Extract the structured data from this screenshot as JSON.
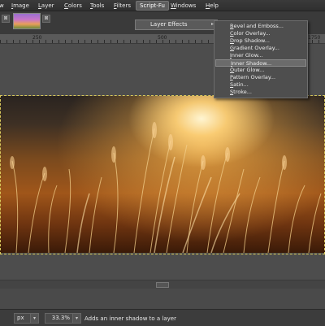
{
  "menubar": {
    "items": [
      {
        "label": "w"
      },
      {
        "label": "Image"
      },
      {
        "label": "Layer"
      },
      {
        "label": "Colors"
      },
      {
        "label": "Tools"
      },
      {
        "label": "Filters"
      },
      {
        "label": "Script-Fu"
      },
      {
        "label": "Windows"
      },
      {
        "label": "Help"
      }
    ]
  },
  "tabs": {
    "close_glyph": "⊠"
  },
  "ruler": {
    "labels": [
      "250",
      "500",
      "1750"
    ]
  },
  "layer_effects_menu": {
    "label": "Layer Effects",
    "arrow": "▸"
  },
  "submenu": {
    "items": [
      {
        "label": "Bevel and Emboss..."
      },
      {
        "label": "Color Overlay..."
      },
      {
        "label": "Drop Shadow..."
      },
      {
        "label": "Gradient Overlay..."
      },
      {
        "label": "Inner Glow..."
      },
      {
        "label": "Inner Shadow..."
      },
      {
        "label": "Outer Glow..."
      },
      {
        "label": "Pattern Overlay..."
      },
      {
        "label": "Satin..."
      },
      {
        "label": "Stroke..."
      }
    ],
    "highlighted_index": 5
  },
  "statusbar": {
    "unit": "px",
    "zoom": "33.3%",
    "message": "Adds an inner shadow to a layer"
  },
  "colors": {
    "selection_border": "#d8c85a",
    "highlight": "#6b6b6b"
  }
}
